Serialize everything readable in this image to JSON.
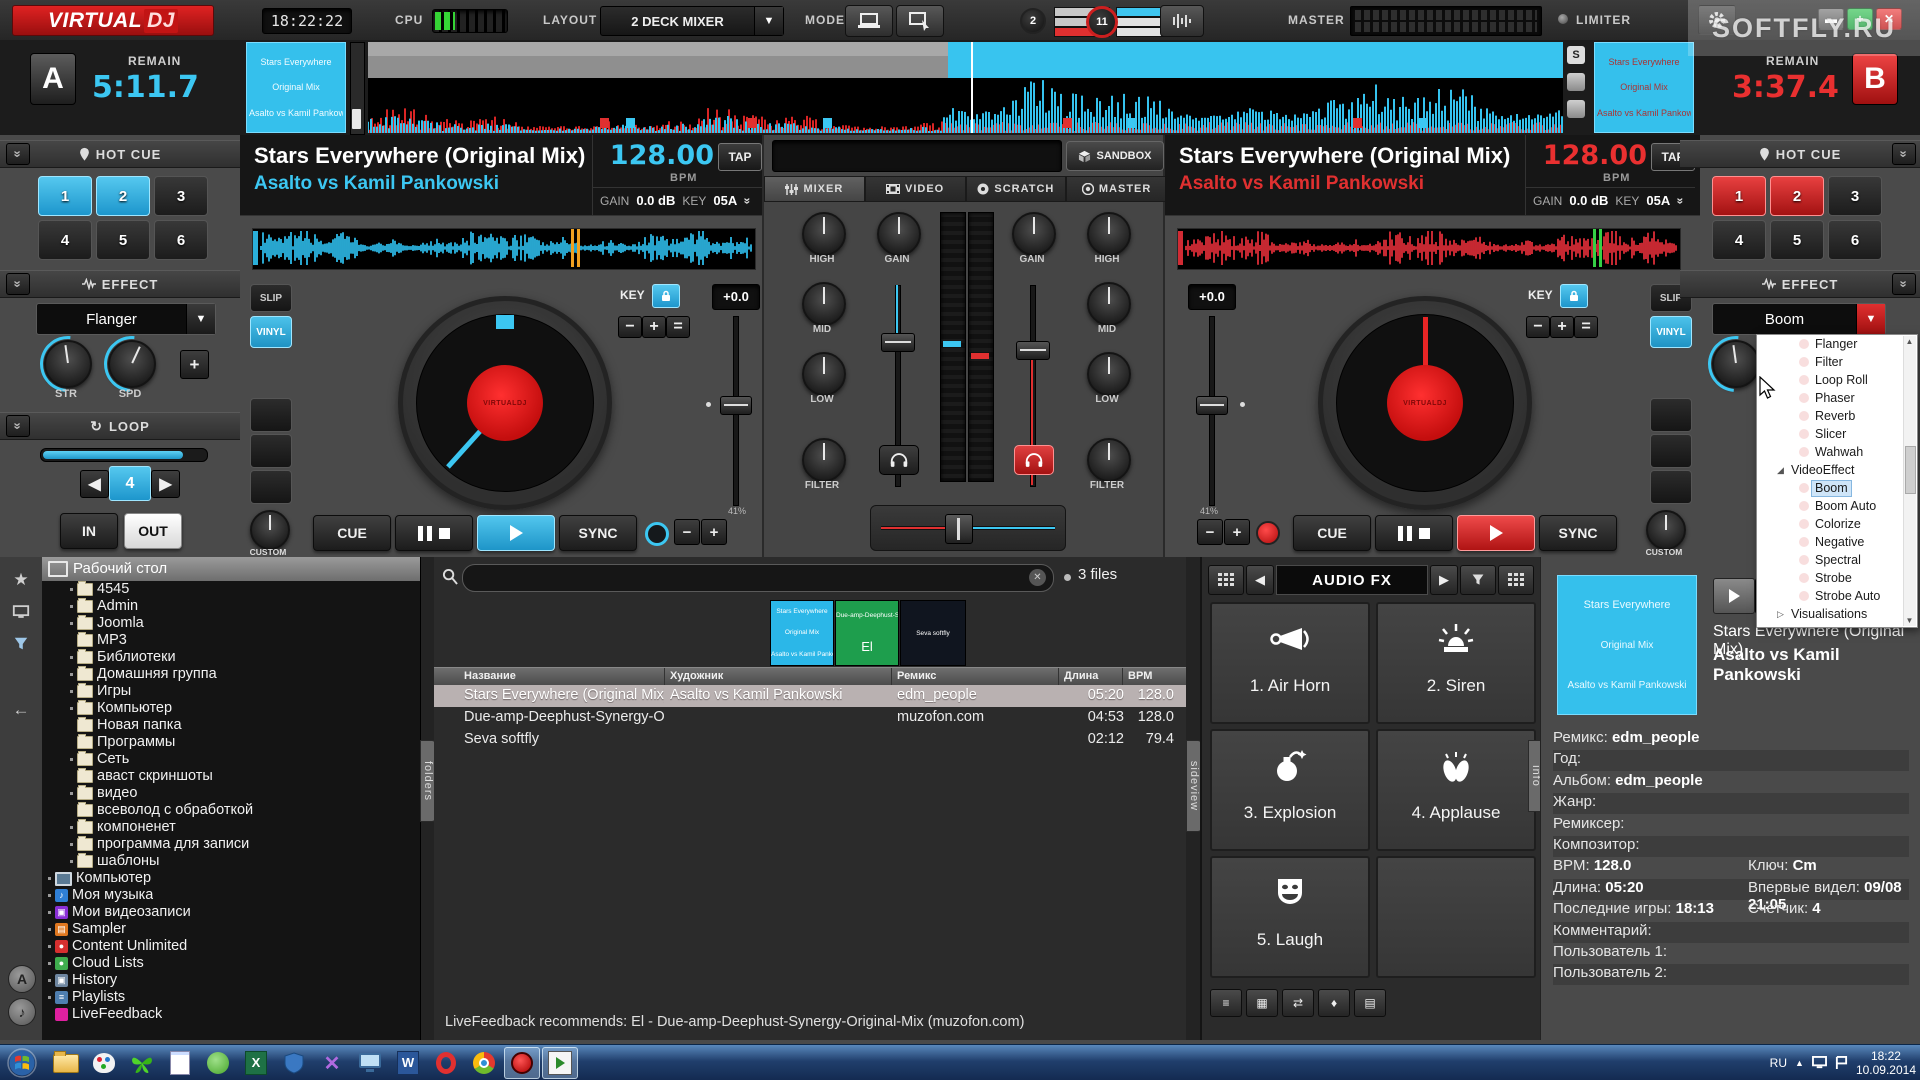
{
  "topbar": {
    "logo_virtual": "VIRTUAL",
    "logo_dj": "DJ",
    "clock": "18:22:22",
    "cpu_label": "CPU",
    "layout_label": "LAYOUT",
    "layout_value": "2 DECK MIXER",
    "mode_label": "MODE",
    "deck_count_badge": "2",
    "deck_select_badge": "11",
    "master_label": "MASTER",
    "limiter_label": "LIMITER",
    "indicator_colors_left": [
      "#c8c8c8",
      "#c8c8c8",
      "#e03030"
    ],
    "indicator_colors_right": [
      "#3ec6f0",
      "#e2e2e2",
      "#e2e2e2"
    ],
    "accent_cyan": "#3cc7f2",
    "accent_red": "#e02525"
  },
  "watermark": {
    "text": "SOFTFLY.RU"
  },
  "overview": {
    "remain_label": "REMAIN",
    "deck_a": {
      "badge": "A",
      "remain": "5:11.7",
      "tile_lines": [
        "Stars Everywhere",
        "Original Mix",
        "Asalto vs Kamil Pankowski"
      ]
    },
    "deck_b": {
      "badge": "B",
      "remain": "3:37.4",
      "tile_lines": [
        "Stars Everywhere",
        "Original Mix",
        "Asalto vs Kamil Pankowski"
      ]
    },
    "s_button": "S"
  },
  "left_panels": {
    "hot_cue": {
      "title": "HOT CUE",
      "buttons": [
        "1",
        "2",
        "3",
        "4",
        "5",
        "6"
      ],
      "active_count": 2
    },
    "effect": {
      "title": "EFFECT",
      "selected": "Flanger",
      "knob_labels": [
        "STR",
        "SPD"
      ],
      "add_button": "+"
    },
    "loop": {
      "title": "LOOP",
      "value": "4",
      "in_label": "IN",
      "out_label": "OUT"
    }
  },
  "right_panels": {
    "hot_cue": {
      "title": "HOT CUE",
      "buttons": [
        "1",
        "2",
        "3",
        "4",
        "5",
        "6"
      ],
      "active_count": 2
    },
    "effect": {
      "title": "EFFECT",
      "selected": "Boom"
    }
  },
  "effect_menu": {
    "items": [
      {
        "label": "Flanger",
        "depth": 2
      },
      {
        "label": "Filter",
        "depth": 2
      },
      {
        "label": "Loop Roll",
        "depth": 2
      },
      {
        "label": "Phaser",
        "depth": 2
      },
      {
        "label": "Reverb",
        "depth": 2
      },
      {
        "label": "Slicer",
        "depth": 2
      },
      {
        "label": "Wahwah",
        "depth": 2
      },
      {
        "label": "VideoEffect",
        "depth": 1,
        "state": "expanded"
      },
      {
        "label": "Boom",
        "depth": 2,
        "selected": true
      },
      {
        "label": "Boom Auto",
        "depth": 2
      },
      {
        "label": "Colorize",
        "depth": 2
      },
      {
        "label": "Negative",
        "depth": 2
      },
      {
        "label": "Spectral",
        "depth": 2
      },
      {
        "label": "Strobe",
        "depth": 2
      },
      {
        "label": "Strobe Auto",
        "depth": 2
      },
      {
        "label": "Visualisations",
        "depth": 1,
        "state": "collapsed"
      }
    ]
  },
  "deck_a": {
    "title": "Stars Everywhere (Original Mix)",
    "artist": "Asalto vs Kamil Pankowski",
    "bpm": "128.00",
    "bpm_label": "BPM",
    "tap_label": "TAP",
    "gain_label": "GAIN",
    "gain_value": "0.0 dB",
    "key_label": "KEY",
    "key_value": "05A",
    "slip_label": "SLIP",
    "vinyl_label": "VINYL",
    "key_panel": {
      "label": "KEY",
      "minus": "−",
      "plus": "+",
      "reset": "="
    },
    "pitch_value": "+0.0",
    "pitch_percent": "41%",
    "custom_label": "CUSTOM",
    "cue_label": "CUE",
    "sync_label": "SYNC"
  },
  "deck_b": {
    "title": "Stars Everywhere (Original Mix)",
    "artist": "Asalto vs Kamil Pankowski",
    "bpm": "128.00",
    "bpm_label": "BPM",
    "tap_label": "TAP",
    "gain_label": "GAIN",
    "gain_value": "0.0 dB",
    "key_label": "KEY",
    "key_value": "05A",
    "slip_label": "SLIP",
    "vinyl_label": "VINYL",
    "key_panel": {
      "label": "KEY",
      "minus": "−",
      "plus": "+",
      "reset": "="
    },
    "pitch_value": "+0.0",
    "pitch_percent": "41%",
    "custom_label": "CUSTOM",
    "cue_label": "CUE",
    "sync_label": "SYNC"
  },
  "mixer": {
    "sandbox_label": "SANDBOX",
    "tabs": [
      "MIXER",
      "VIDEO",
      "SCRATCH",
      "MASTER"
    ],
    "active_tab": "MIXER",
    "eq_labels": [
      "HIGH",
      "MID",
      "LOW"
    ],
    "filter_label": "FILTER",
    "gain_label": "GAIN"
  },
  "browser": {
    "tree": [
      {
        "label": "Рабочий стол",
        "icon": "desktop",
        "depth": 0,
        "root": true
      },
      {
        "label": "4545",
        "icon": "folder",
        "depth": 1,
        "dot": true
      },
      {
        "label": "Admin",
        "icon": "folder",
        "depth": 1,
        "dot": true
      },
      {
        "label": "Joomla",
        "icon": "folder",
        "depth": 1,
        "dot": true
      },
      {
        "label": "MP3",
        "icon": "folder",
        "depth": 1,
        "dot": false
      },
      {
        "label": "Библиотеки",
        "icon": "folder",
        "depth": 1,
        "dot": true
      },
      {
        "label": "Домашняя группа",
        "icon": "folder",
        "depth": 1,
        "dot": true
      },
      {
        "label": "Игры",
        "icon": "folder",
        "depth": 1,
        "dot": true
      },
      {
        "label": "Компьютер",
        "icon": "folder",
        "depth": 1,
        "dot": true
      },
      {
        "label": "Новая папка",
        "icon": "folder",
        "depth": 1,
        "dot": false
      },
      {
        "label": "Программы",
        "icon": "folder",
        "depth": 1,
        "dot": false
      },
      {
        "label": "Сеть",
        "icon": "folder",
        "depth": 1,
        "dot": true
      },
      {
        "label": "аваст скриншоты",
        "icon": "folder",
        "depth": 1,
        "dot": false
      },
      {
        "label": "видео",
        "icon": "folder",
        "depth": 1,
        "dot": true
      },
      {
        "label": "всеволод с обработкой",
        "icon": "folder",
        "depth": 1,
        "dot": false
      },
      {
        "label": "компоненет",
        "icon": "folder",
        "depth": 1,
        "dot": true
      },
      {
        "label": "программа для записи",
        "icon": "folder",
        "depth": 1,
        "dot": true
      },
      {
        "label": "шаблоны",
        "icon": "folder",
        "depth": 1,
        "dot": true
      },
      {
        "label": "Компьютер",
        "icon": "computer",
        "depth": 0,
        "dot": true
      },
      {
        "label": "Моя музыка",
        "icon": "music",
        "depth": 0,
        "dot": true
      },
      {
        "label": "Мои видеозаписи",
        "icon": "video",
        "depth": 0,
        "dot": true
      },
      {
        "label": "Sampler",
        "icon": "sampler",
        "depth": 0,
        "dot": true
      },
      {
        "label": "Content Unlimited",
        "icon": "content",
        "depth": 0,
        "dot": true
      },
      {
        "label": "Cloud Lists",
        "icon": "cloud",
        "depth": 0,
        "dot": true
      },
      {
        "label": "History",
        "icon": "history",
        "depth": 0,
        "dot": true
      },
      {
        "label": "Playlists",
        "icon": "playlists",
        "depth": 0,
        "dot": true
      },
      {
        "label": "LiveFeedback",
        "icon": "livefeedback",
        "depth": 0,
        "dot": false
      }
    ],
    "tabs": {
      "folders": "folders",
      "sideview": "sideview",
      "info": "info"
    },
    "search": {
      "placeholder": "",
      "count": "3 files"
    },
    "tiles": [
      {
        "lines": [
          "Stars Everywhere",
          "Original Mix",
          "Asalto vs Kamil Pankowski"
        ],
        "color": "#2bb7e8"
      },
      {
        "lines": [
          "Due-amp-Deephust-Synergy-Orig",
          "El"
        ],
        "color": "#1e9e4d"
      },
      {
        "lines": [
          "Seva softfly"
        ],
        "color": "#10151f"
      }
    ],
    "columns": [
      "Название",
      "Художник",
      "Ремикс",
      "Длина",
      "BPM"
    ],
    "rows": [
      {
        "name": "Stars Everywhere (Original Mix)",
        "artist": "Asalto vs Kamil Pankowski",
        "remix": "edm_people",
        "length": "05:20",
        "bpm": "128.0",
        "selected": true
      },
      {
        "name": "Due-amp-Deephust-Synergy-Original-Mix El",
        "artist": "",
        "remix": "muzofon.com",
        "length": "04:53",
        "bpm": "128.0",
        "selected": false
      },
      {
        "name": "Seva softfly",
        "artist": "",
        "remix": "",
        "length": "02:12",
        "bpm": "79.4",
        "selected": false
      }
    ],
    "status": "LiveFeedback recommends: El - Due-amp-Deephust-Synergy-Original-Mix (muzofon.com)"
  },
  "audio_fx": {
    "title": "AUDIO FX",
    "pads": [
      {
        "label": "1. Air Horn",
        "icon": "air-horn"
      },
      {
        "label": "2. Siren",
        "icon": "siren"
      },
      {
        "label": "3. Explosion",
        "icon": "explosion"
      },
      {
        "label": "4. Applause",
        "icon": "applause"
      },
      {
        "label": "5. Laugh",
        "icon": "laugh"
      },
      {
        "label": "",
        "icon": ""
      }
    ]
  },
  "info_panel": {
    "art_lines": [
      "Stars Everywhere",
      "Original Mix",
      "Asalto vs Kamil Pankowski"
    ],
    "title": "Stars Everywhere (Original Mix)",
    "artist": "Asalto vs Kamil Pankowski",
    "fields": [
      [
        {
          "label": "Ремикс:",
          "value": "edm_people"
        }
      ],
      [
        {
          "label": "Год:",
          "value": ""
        }
      ],
      [
        {
          "label": "Альбом:",
          "value": "edm_people"
        }
      ],
      [
        {
          "label": "Жанр:",
          "value": ""
        }
      ],
      [
        {
          "label": "Ремиксер:",
          "value": ""
        }
      ],
      [
        {
          "label": "Композитор:",
          "value": ""
        }
      ],
      [
        {
          "label": "BPM:",
          "value": "128.0"
        },
        {
          "label": "Ключ:",
          "value": "Cm"
        }
      ],
      [
        {
          "label": "Длина:",
          "value": "05:20"
        },
        {
          "label": "Впервые видел:",
          "value": "09/08 21:05"
        }
      ],
      [
        {
          "label": "Последние игры:",
          "value": "18:13"
        },
        {
          "label": "Счетчик:",
          "value": "4"
        }
      ],
      [
        {
          "label": "Комментарий:",
          "value": ""
        }
      ],
      [
        {
          "label": "Пользователь 1:",
          "value": ""
        }
      ],
      [
        {
          "label": "Пользователь 2:",
          "value": ""
        }
      ]
    ]
  },
  "taskbar": {
    "icons": [
      "start",
      "explorer",
      "paint",
      "butterfly",
      "notepad",
      "viber",
      "excel",
      "shield",
      "xsplit",
      "pc",
      "word",
      "opera",
      "chrome",
      "red-app",
      "player"
    ],
    "active_icons": [
      "red-app",
      "player"
    ],
    "tray_language": "RU",
    "time": "18:22",
    "date": "10.09.2014"
  }
}
